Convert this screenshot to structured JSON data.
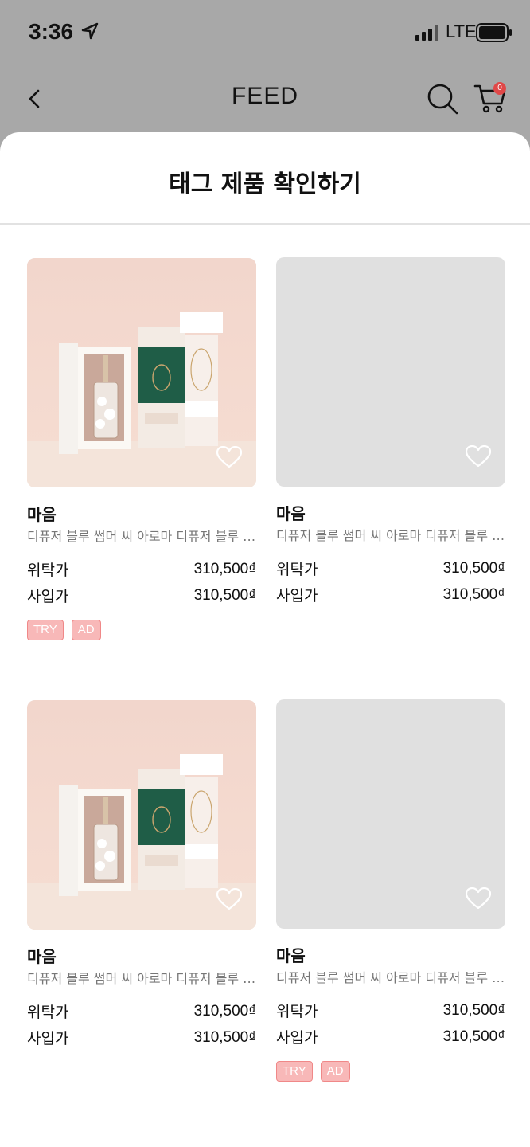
{
  "status_bar": {
    "time": "3:36",
    "network": "LTE",
    "icons": [
      "location-arrow-icon",
      "signal-icon",
      "battery-icon"
    ]
  },
  "nav": {
    "title": "FEED",
    "cart_count": "0",
    "icons": [
      "back-icon",
      "search-icon",
      "cart-icon"
    ]
  },
  "sheet": {
    "title": "태그 제품 확인하기"
  },
  "colors": {
    "tag_bg": "#f8b8b8",
    "tag_border": "#f08888",
    "badge": "#e04848",
    "placeholder": "#e0e0e0"
  },
  "products": [
    {
      "brand": "마음",
      "description": "디퓨저 블루 썸머 씨 아로마 디퓨저 블루 썸머 씨 아로마",
      "consign_label": "위탁가",
      "consign_price": "310,500₫",
      "purchase_label": "사입가",
      "purchase_price": "310,500₫",
      "has_image": true,
      "tags": [
        "TRY",
        "AD"
      ]
    },
    {
      "brand": "마음",
      "description": "디퓨저 블루 썸머 씨 아로마 디퓨저 블루 썸머 씨 아로마",
      "consign_label": "위탁가",
      "consign_price": "310,500₫",
      "purchase_label": "사입가",
      "purchase_price": "310,500₫",
      "has_image": false,
      "tags": []
    },
    {
      "brand": "마음",
      "description": "디퓨저 블루 썸머 씨 아로마 디퓨저 블루 썸머 씨 아로마",
      "consign_label": "위탁가",
      "consign_price": "310,500₫",
      "purchase_label": "사입가",
      "purchase_price": "310,500₫",
      "has_image": true,
      "tags": []
    },
    {
      "brand": "마음",
      "description": "디퓨저 블루 썸머 씨 아로마 디퓨저 블루 썸머 씨 아로마",
      "consign_label": "위탁가",
      "consign_price": "310,500₫",
      "purchase_label": "사입가",
      "purchase_price": "310,500₫",
      "has_image": false,
      "tags": [
        "TRY",
        "AD"
      ]
    }
  ]
}
